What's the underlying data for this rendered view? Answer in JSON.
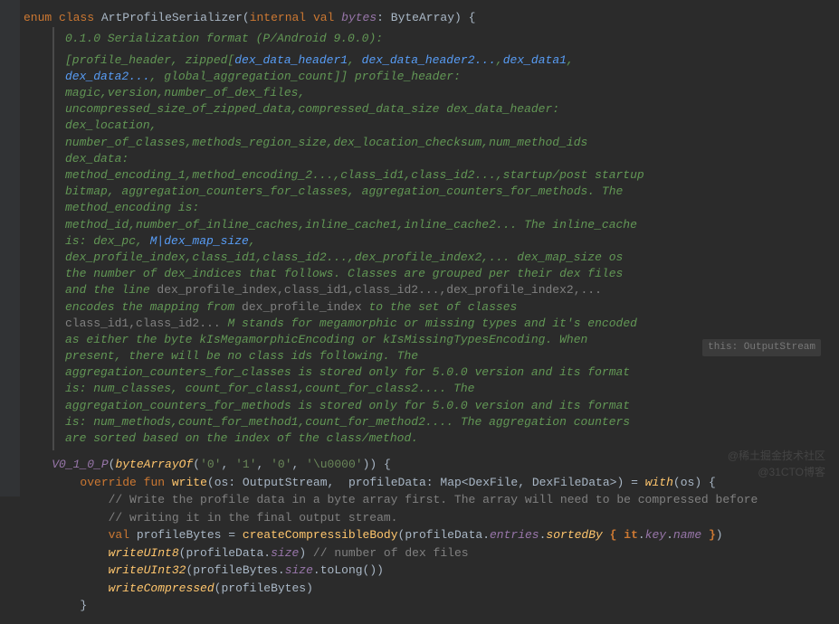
{
  "decl": {
    "enum": "enum",
    "class": "class",
    "name": "ArtProfileSerializer",
    "internal": "internal",
    "val": "val",
    "param": "bytes",
    "paramType": "ByteArray",
    "brace": "{"
  },
  "doc": {
    "intro": "0.1.0 Serialization format (P/Android 9.0.0):",
    "parts": [
      {
        "t": "[profile_header, zipped["
      },
      {
        "l": "dex_data_header1"
      },
      {
        "t": ", "
      },
      {
        "l": "dex_data_header2..."
      },
      {
        "t": ","
      },
      {
        "l": "dex_data1"
      },
      {
        "t": ", "
      },
      {
        "l": "dex_data2..."
      },
      {
        "t": ", global_aggregation_count]] profile_header: magic,version,number_of_dex_files, uncompressed_size_of_zipped_data,compressed_data_size dex_data_header: dex_location, number_of_classes,methods_region_size,dex_location_checksum,num_method_ids dex_data: method_encoding_1,method_encoding_2...,class_id1,class_id2...,startup/post startup bitmap, aggregation_counters_for_classes, aggregation_counters_for_methods. The method_encoding is: method_id,number_of_inline_caches,inline_cache1,inline_cache2... The inline_cache is: dex_pc, "
      },
      {
        "l": "M|dex_map_size"
      },
      {
        "t": ", dex_profile_index,class_id1,class_id2...,dex_profile_index2,... dex_map_size os the number of dex_indices that follows. Classes are grouped per their dex files and the line "
      },
      {
        "m": "dex_profile_index,class_id1,class_id2...,dex_profile_index2,..."
      },
      {
        "t": " encodes the mapping from "
      },
      {
        "m": "dex_profile_index"
      },
      {
        "t": " to the set of classes "
      },
      {
        "m": "class_id1,class_id2..."
      },
      {
        "t": " M stands for megamorphic or missing types and it's encoded as either the byte kIsMegamorphicEncoding or kIsMissingTypesEncoding. When present, there will be no class ids following. The aggregation_counters_for_classes is stored only for 5.0.0 version and its format is: num_classes, count_for_class1,count_for_class2.... The aggregation_counters_for_methods is stored only for 5.0.0 version and its format is: num_methods,count_for_method1,count_for_method2.... The aggregation counters are sorted based on the index of the class/method."
      }
    ]
  },
  "enumEntry": {
    "name": "V0_1_0_P",
    "call": "byteArrayOf",
    "args": [
      "'0'",
      "'1'",
      "'0'",
      "'\\u0000'"
    ],
    "brace": "{"
  },
  "override": {
    "override": "override",
    "fun": "fun",
    "name": "write",
    "p1": "os",
    "p1t": "OutputStream",
    "p2": "profileData",
    "p2t1": "Map",
    "p2t2": "DexFile",
    "p2t3": "DexFileData",
    "eq": "=",
    "with": "with",
    "withArg": "os",
    "brace": "{"
  },
  "hint": "this: OutputStream",
  "comments": {
    "c1": "// Write the profile data in a byte array first. The array will need to be compressed before",
    "c2": "// writing it in the final output stream.",
    "c3": "// number of dex files"
  },
  "body": {
    "val": "val",
    "var1": "profileBytes",
    "eq": "=",
    "call1": "createCompressibleBody",
    "arg1": "profileData",
    "prop1": "entries",
    "ext1": "sortedBy",
    "lbrace": "{",
    "it": "it",
    "key": "key",
    "name": "name",
    "rbrace": "}",
    "call2": "writeUInt8",
    "arg2": "profileData",
    "prop2": "size",
    "call3": "writeUInt32",
    "arg3": "profileBytes",
    "prop3": "size",
    "toLong": "toLong",
    "call4": "writeCompressed",
    "arg4": "profileBytes"
  },
  "close": "}",
  "watermark1": "@稀土掘金技术社区",
  "watermark2": "@31CTO博客"
}
